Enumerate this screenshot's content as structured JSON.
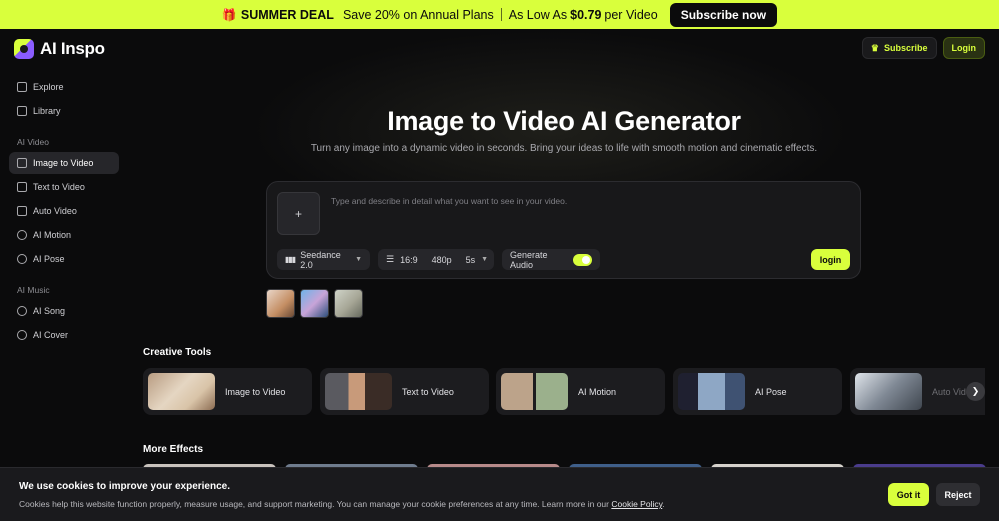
{
  "promo": {
    "deal": "SUMMER DEAL",
    "offer": "Save 20% on Annual Plans",
    "as_low_as": "As Low As",
    "price": "$0.79",
    "per": "per Video",
    "cta": "Subscribe now"
  },
  "header": {
    "logo_text": "AI Inspo",
    "subscribe_label": "Subscribe",
    "login_label": "Login"
  },
  "sidebar": {
    "top_items": [
      {
        "label": "Explore",
        "icon": "grid-icon"
      },
      {
        "label": "Library",
        "icon": "folder-icon"
      }
    ],
    "section_video": "AI Video",
    "video_items": [
      {
        "label": "Image to Video",
        "icon": "image-video-icon",
        "active": true
      },
      {
        "label": "Text to Video",
        "icon": "text-video-icon"
      },
      {
        "label": "Auto Video",
        "icon": "auto-video-icon"
      },
      {
        "label": "AI Motion",
        "icon": "motion-icon"
      },
      {
        "label": "AI Pose",
        "icon": "pose-icon"
      }
    ],
    "section_music": "AI Music",
    "music_items": [
      {
        "label": "AI Song",
        "icon": "music-note-icon"
      },
      {
        "label": "AI Cover",
        "icon": "cover-icon"
      }
    ]
  },
  "hero": {
    "title": "Image to Video AI Generator",
    "subtitle": "Turn any image into a dynamic video in seconds. Bring your ideas to life with smooth motion and cinematic effects."
  },
  "composer": {
    "upload_symbol": "+",
    "placeholder": "Type and describe in detail what you want to see in your video.",
    "model": "Seedance 2.0",
    "ratio": "16:9",
    "resolution": "480p",
    "duration": "5s",
    "audio_label": "Generate Audio",
    "audio_on": true,
    "submit_label": "login"
  },
  "creative_tools": {
    "title": "Creative Tools",
    "items": [
      {
        "label": "Image to Video"
      },
      {
        "label": "Text to Video"
      },
      {
        "label": "AI Motion"
      },
      {
        "label": "AI Pose"
      },
      {
        "label": "Auto Video"
      }
    ]
  },
  "more_effects": {
    "title": "More Effects"
  },
  "cookie": {
    "title": "We use cookies to improve your experience.",
    "text": "Cookies help this website function properly, measure usage, and support marketing. You can manage your cookie preferences at any time. Learn more in our",
    "link": "Cookie Policy",
    "end": ".",
    "accept_label": "Got it",
    "reject_label": "Reject"
  },
  "colors": {
    "accent": "#d9ff3c",
    "background": "#0b0b0c",
    "panel": "#18181a"
  }
}
